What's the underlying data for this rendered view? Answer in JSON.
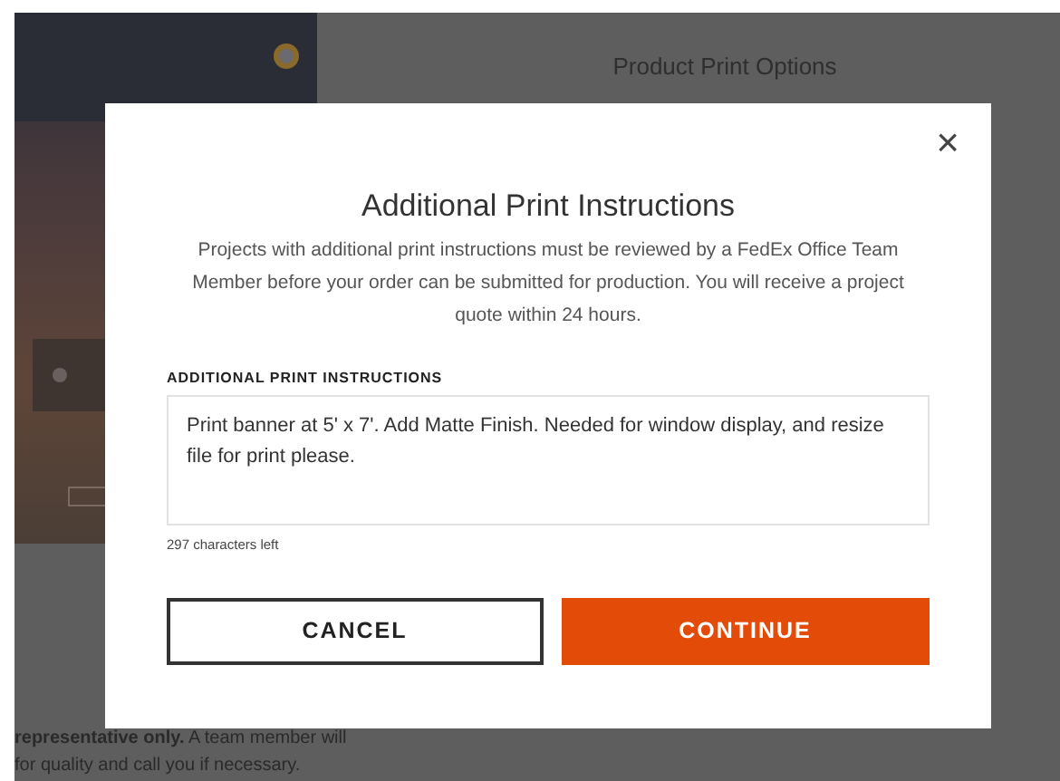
{
  "page": {
    "section_title": "Product Print Options",
    "note_lines": [
      "**representative only.** A team member will",
      "for quality and call you if necessary."
    ]
  },
  "dialog": {
    "close": "×",
    "title": "Additional Print Instructions",
    "description": "Projects with additional print instructions must be reviewed by a FedEx Office Team Member before your order can be submitted for production. You will receive a project quote within 24 hours.",
    "field_label": "ADDITIONAL PRINT INSTRUCTIONS",
    "field_value": "Print banner at 5' x 7'. Add Matte Finish. Needed for window display, and resize file for print please.",
    "counter": "297 characters left",
    "buttons": [
      {
        "label": "CANCEL",
        "kind": "secondary"
      },
      {
        "label": "CONTINUE",
        "kind": "primary"
      }
    ]
  }
}
